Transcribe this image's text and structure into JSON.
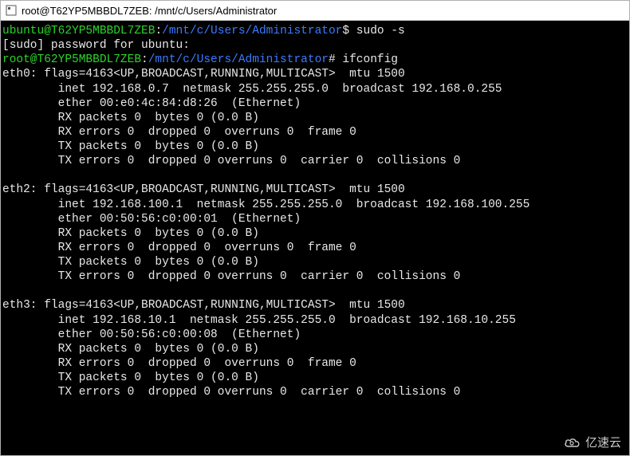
{
  "window": {
    "title": "root@T62YP5MBBDL7ZEB: /mnt/c/Users/Administrator"
  },
  "prompt1": {
    "user_host": "ubuntu@T62YP5MBBDL7ZEB",
    "colon": ":",
    "path": "/mnt/c/Users/Administrator",
    "dollar": "$ ",
    "cmd": "sudo -s"
  },
  "sudo_line": "[sudo] password for ubuntu:",
  "prompt2": {
    "user_host": "root@T62YP5MBBDL7ZEB",
    "colon": ":",
    "path": "/mnt/c/Users/Administrator",
    "hash": "# ",
    "cmd": "ifconfig"
  },
  "eth0": {
    "l1": "eth0: flags=4163<UP,BROADCAST,RUNNING,MULTICAST>  mtu 1500",
    "l2": "        inet 192.168.0.7  netmask 255.255.255.0  broadcast 192.168.0.255",
    "l3": "        ether 00:e0:4c:84:d8:26  (Ethernet)",
    "l4": "        RX packets 0  bytes 0 (0.0 B)",
    "l5": "        RX errors 0  dropped 0  overruns 0  frame 0",
    "l6": "        TX packets 0  bytes 0 (0.0 B)",
    "l7": "        TX errors 0  dropped 0 overruns 0  carrier 0  collisions 0"
  },
  "eth2": {
    "l1": "eth2: flags=4163<UP,BROADCAST,RUNNING,MULTICAST>  mtu 1500",
    "l2": "        inet 192.168.100.1  netmask 255.255.255.0  broadcast 192.168.100.255",
    "l3": "        ether 00:50:56:c0:00:01  (Ethernet)",
    "l4": "        RX packets 0  bytes 0 (0.0 B)",
    "l5": "        RX errors 0  dropped 0  overruns 0  frame 0",
    "l6": "        TX packets 0  bytes 0 (0.0 B)",
    "l7": "        TX errors 0  dropped 0 overruns 0  carrier 0  collisions 0"
  },
  "eth3": {
    "l1": "eth3: flags=4163<UP,BROADCAST,RUNNING,MULTICAST>  mtu 1500",
    "l2": "        inet 192.168.10.1  netmask 255.255.255.0  broadcast 192.168.10.255",
    "l3": "        ether 00:50:56:c0:00:08  (Ethernet)",
    "l4": "        RX packets 0  bytes 0 (0.0 B)",
    "l5": "        RX errors 0  dropped 0  overruns 0  frame 0",
    "l6": "        TX packets 0  bytes 0 (0.0 B)",
    "l7": "        TX errors 0  dropped 0 overruns 0  carrier 0  collisions 0"
  },
  "watermark": "亿速云"
}
